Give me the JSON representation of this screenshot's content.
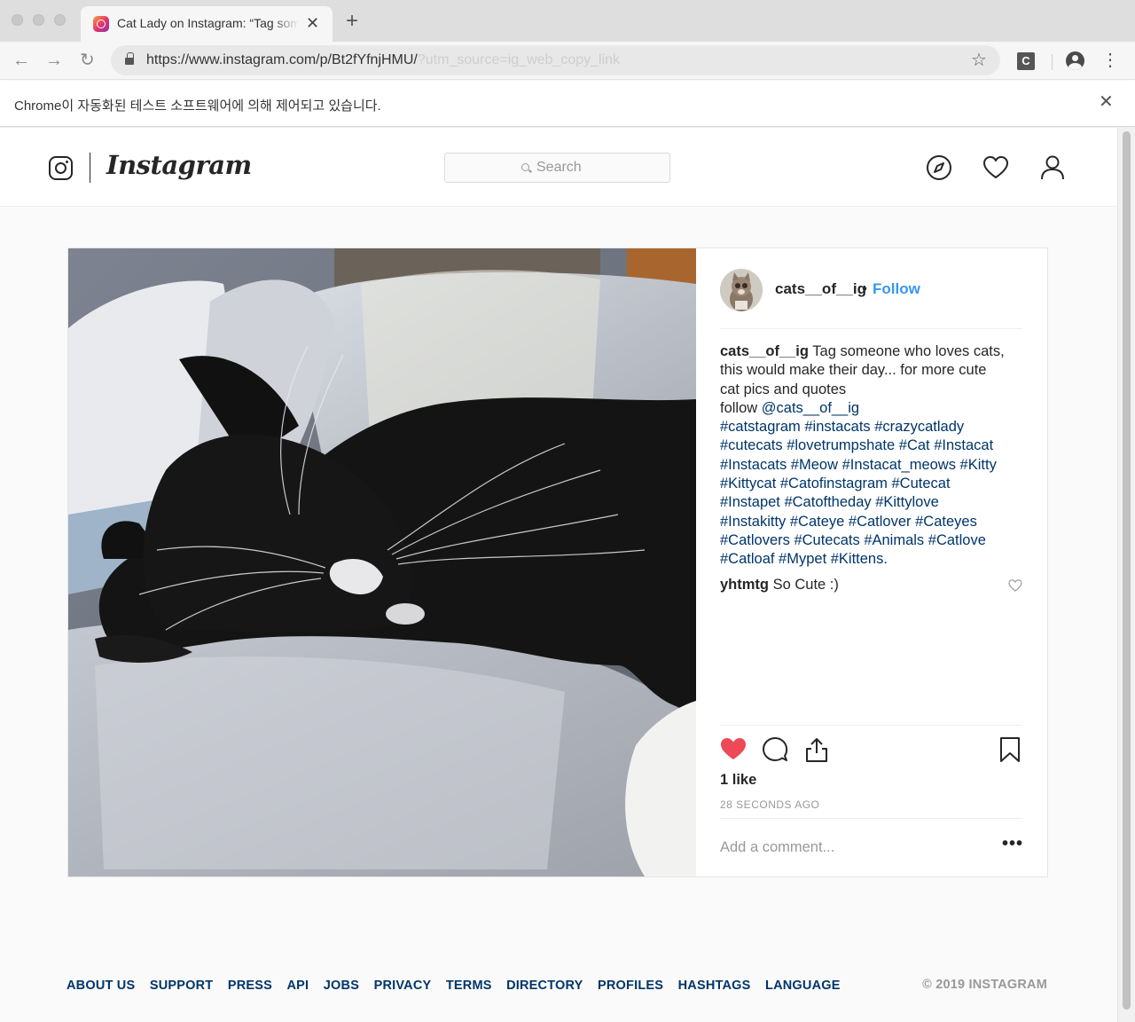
{
  "browser": {
    "tab_title": "Cat Lady on Instagram: “Tag someone who loves cats",
    "url_main": "https://www.instagram.com/p/Bt2fYfnjHMU/",
    "url_suffix": "?utm_source=ig_web_copy_link",
    "extension_letter": "C",
    "infobar_text": "Chrome이 자동화된 테스트 소프트웨어에 의해 제어되고 있습니다."
  },
  "header": {
    "wordmark": "Instagram",
    "search_placeholder": "Search"
  },
  "post": {
    "username": "cats__of__ig",
    "bullet": "•",
    "follow_label": "Follow",
    "caption_username": "cats__of__ig",
    "caption_lines": [
      "Tag someone who loves cats,",
      "this would make their day... for more cute",
      "cat pics and quotes",
      "follow"
    ],
    "mention": "@cats__of__ig",
    "hashtag_lines": [
      "#catstagram #instacats #crazycatlady",
      "#cutecats #lovetrumpshate #Cat #Instacat",
      "#Instacats #Meow #Instacat_meows #Kitty",
      "#Kittycat #Catofinstagram #Cutecat",
      "#Instapet #Catoftheday #Kittylove",
      "#Instakitty #Cateye #Catlover #Cateyes",
      "#Catlovers #Cutecats #Animals #Catlove",
      "#Catloaf #Mypet #Kittens."
    ],
    "comment_username": "yhtmtg",
    "comment_text": "So Cute :)",
    "likes": "1 like",
    "timestamp": "28 SECONDS AGO",
    "add_comment_placeholder": "Add a comment...",
    "liked": true,
    "like_color": "#ed4956"
  },
  "footer": {
    "links": [
      "ABOUT US",
      "SUPPORT",
      "PRESS",
      "API",
      "JOBS",
      "PRIVACY",
      "TERMS",
      "DIRECTORY",
      "PROFILES",
      "HASHTAGS",
      "LANGUAGE"
    ],
    "copyright": "© 2019 INSTAGRAM"
  },
  "colors": {
    "link_blue": "#3897f0",
    "hashtag_navy": "#003569",
    "text": "#262626",
    "muted": "#999999"
  },
  "icons": [
    "search-icon",
    "compass-icon",
    "heart-icon",
    "profile-icon",
    "like-heart-filled-icon",
    "comment-icon",
    "share-icon",
    "bookmark-icon",
    "more-dots-icon"
  ]
}
